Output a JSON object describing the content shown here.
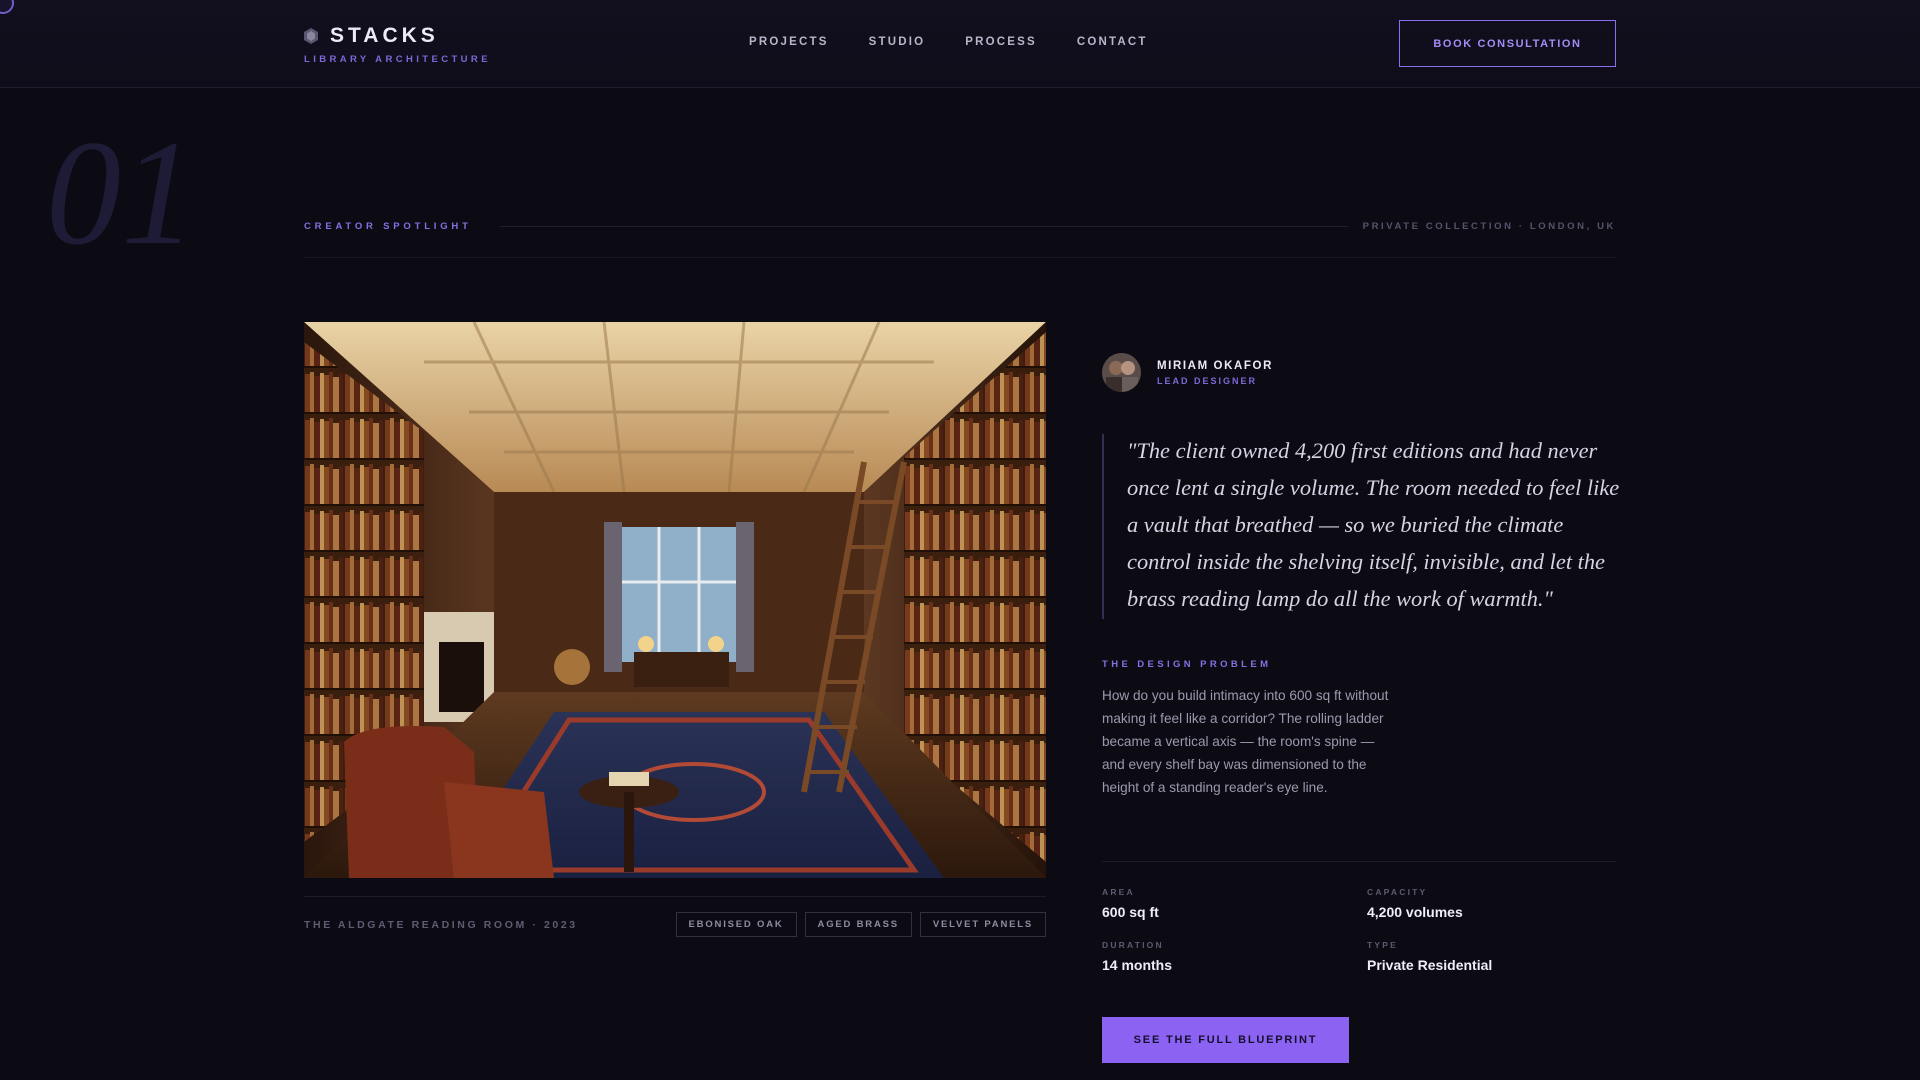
{
  "header": {
    "brand": "STACKS",
    "brand_sub": "LIBRARY ARCHITECTURE",
    "nav": [
      {
        "label": "PROJECTS"
      },
      {
        "label": "STUDIO"
      },
      {
        "label": "PROCESS"
      },
      {
        "label": "CONTACT"
      }
    ],
    "cta": "BOOK CONSULTATION"
  },
  "section": {
    "number": "01",
    "label": "CREATOR SPOTLIGHT",
    "location": "PRIVATE COLLECTION · LONDON, UK"
  },
  "project": {
    "caption": "THE ALDGATE READING ROOM · 2023",
    "tags": [
      "EBONISED OAK",
      "AGED BRASS",
      "VELVET PANELS"
    ]
  },
  "author": {
    "name": "MIRIAM OKAFOR",
    "role": "LEAD DESIGNER"
  },
  "quote": "\"The client owned 4,200 first editions and had never once lent a single volume. The room needed to feel like a vault that breathed — so we buried the climate control inside the shelving itself, invisible, and let the brass reading lamp do all the work of warmth.\"",
  "problem": {
    "label": "THE DESIGN PROBLEM",
    "text": "How do you build intimacy into 600 sq ft without making it feel like a corridor? The rolling ladder became a vertical axis — the room's spine — and every shelf bay was dimensioned to the height of a standing reader's eye line."
  },
  "stats": [
    {
      "label": "AREA",
      "value": "600 sq ft"
    },
    {
      "label": "CAPACITY",
      "value": "4,200 volumes"
    },
    {
      "label": "DURATION",
      "value": "14 months"
    },
    {
      "label": "TYPE",
      "value": "Private Residential"
    }
  ],
  "cta_blueprint": "SEE THE FULL BLUEPRINT",
  "colors": {
    "background": "#0c0b14",
    "accent": "#8c62f2",
    "accent_text": "#8670e4"
  }
}
